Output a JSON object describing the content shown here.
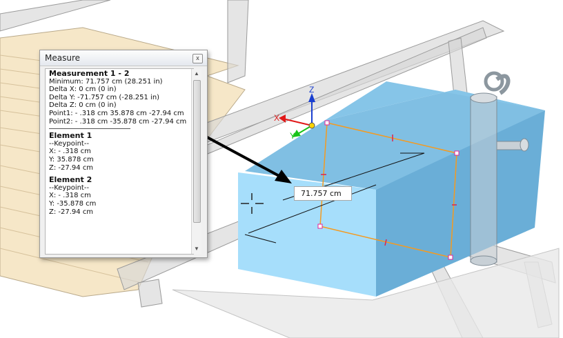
{
  "measure_panel": {
    "title": "Measure",
    "close_glyph": "x",
    "measurement": {
      "heading": "Measurement  1 - 2",
      "minimum": "Minimum:  71.757 cm (28.251 in)",
      "delta_x": "Delta X:  0  cm (0  in)",
      "delta_y": "Delta Y:  -71.757 cm (-28.251 in)",
      "delta_z": "Delta Z:  0  cm (0  in)",
      "point1": "Point1:  - .318 cm 35.878 cm -27.94 cm",
      "point2": "Point2:  - .318 cm -35.878 cm -27.94 cm"
    },
    "element1": {
      "heading": "Element  1",
      "type": "--Keypoint--",
      "x": "X:  - .318 cm",
      "y": "Y:  35.878 cm",
      "z": "Z:  -27.94 cm"
    },
    "element2": {
      "heading": "Element  2",
      "type": "--Keypoint--",
      "x": "X:  - .318 cm",
      "y": "Y:  -35.878 cm",
      "z": "Z:  -27.94 cm"
    }
  },
  "viewport": {
    "dimension_label": "71.757 cm",
    "axis_labels": {
      "x": "X",
      "y": "Y",
      "z": "Z"
    },
    "colors": {
      "box_face": "#8fd2f2",
      "box_side": "#6aaed7",
      "box_top": "#80bfe3",
      "selection_outline": "#f59a1f",
      "axis_x": "#e01818",
      "axis_y": "#17c317",
      "axis_z": "#1a3fd0",
      "deck_wood": "#f6e7c8",
      "frame_gray": "#d8d8d8"
    }
  }
}
